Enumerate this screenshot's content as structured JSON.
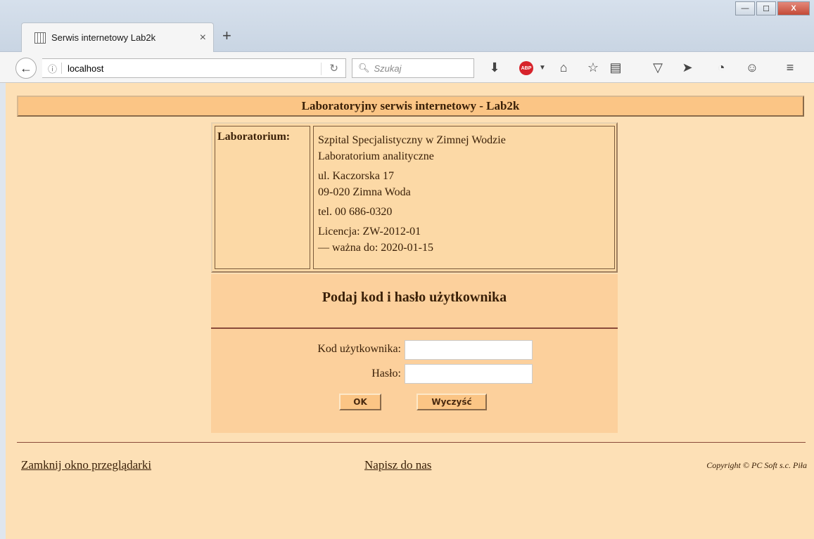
{
  "browser": {
    "tab_title": "Serwis internetowy Lab2k",
    "tab_close": "×",
    "new_tab": "+",
    "url": "localhost",
    "search_placeholder": "Szukaj",
    "window_buttons": {
      "minimize": "—",
      "maximize": "☐",
      "close": "X"
    }
  },
  "page": {
    "header": "Laboratoryjny serwis internetowy - Lab2k",
    "lab_label": "Laboratorium:",
    "lab_lines": {
      "name1": "Szpital Specjalistyczny w Zimnej Wodzie",
      "name2": "Laboratorium analityczne",
      "street": "ul. Kaczorska 17",
      "city": "09-020 Zimna Woda",
      "phone": "tel. 00 686-0320",
      "license": "Licencja: ZW-2012-01",
      "valid": "— ważna do: 2020-01-15"
    },
    "login": {
      "title": "Podaj kod i hasło użytkownika",
      "user_label": "Kod użytkownika:",
      "user_value": "",
      "password_label": "Hasło:",
      "password_value": "",
      "ok_button": "OK",
      "clear_button": "Wyczyść"
    },
    "footer": {
      "close_link": "Zamknij okno przeglądarki",
      "write_link": "Napisz do nas",
      "copyright": "Copyright © PC Soft s.c. Piła"
    }
  },
  "colors": {
    "page_bg": "#fde0b6",
    "header_bg": "#fbc585",
    "login_bg": "#fcd09c",
    "text": "#3a2008"
  }
}
